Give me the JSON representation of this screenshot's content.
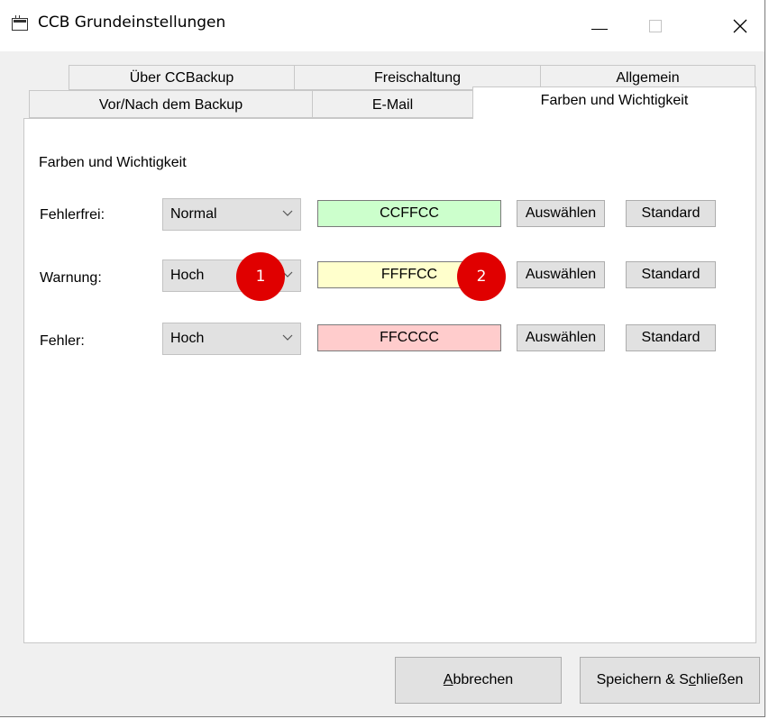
{
  "window": {
    "title": "CCB Grundeinstellungen",
    "minimize_glyph": "—",
    "close_glyph": "✕"
  },
  "tabs": {
    "row1": [
      "Über CCBackup",
      "Freischaltung",
      "Allgemein"
    ],
    "row2": [
      "Vor/Nach dem Backup",
      "E-Mail"
    ],
    "active": "Farben und Wichtigkeit"
  },
  "panel": {
    "section_title": "Farben und Wichtigkeit",
    "rows": [
      {
        "label": "Fehlerfrei:",
        "level": "Normal",
        "color_code": "CCFFCC",
        "color": "#ccffcc",
        "select_label": "Auswählen",
        "default_label": "Standard"
      },
      {
        "label": "Warnung:",
        "level": "Hoch",
        "color_code": "FFFFCC",
        "color": "#ffffcc",
        "select_label": "Auswählen",
        "default_label": "Standard"
      },
      {
        "label": "Fehler:",
        "level": "Hoch",
        "color_code": "FFCCCC",
        "color": "#ffcccc",
        "select_label": "Auswählen",
        "default_label": "Standard"
      }
    ]
  },
  "markers": [
    "1",
    "2"
  ],
  "footer": {
    "cancel_label_a": "A",
    "cancel_label_rest": "bbrechen",
    "save_label_pre": "Speichern & S",
    "save_label_u": "c",
    "save_label_post": "hließen"
  }
}
